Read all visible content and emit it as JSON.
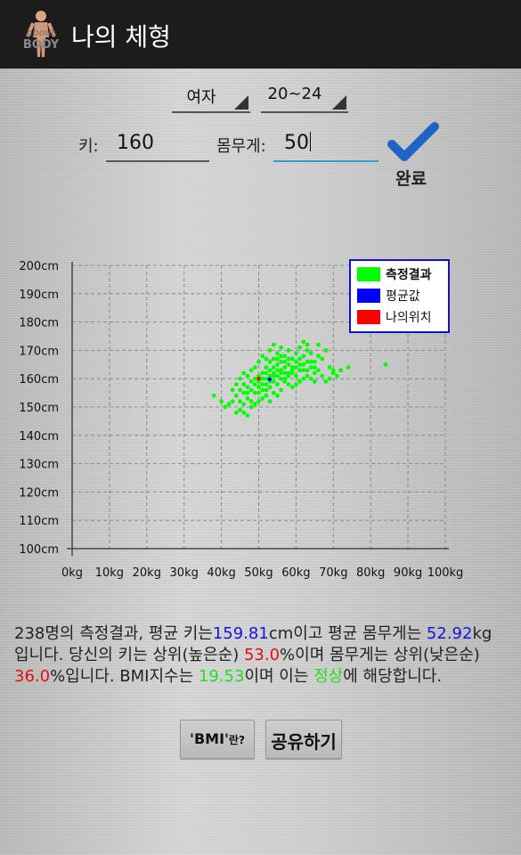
{
  "titlebar": {
    "title": "나의 체형",
    "logo_text_top": "about",
    "logo_text_bottom": "BODY"
  },
  "form": {
    "gender": "여자",
    "age_group": "20~24",
    "height_label": "키:",
    "height_value": "160",
    "weight_label": "몸무게:",
    "weight_value": "50",
    "done_label": "완료"
  },
  "chart_data": {
    "type": "scatter",
    "xlabel": "",
    "ylabel": "",
    "x_ticks": [
      "0kg",
      "10kg",
      "20kg",
      "30kg",
      "40kg",
      "50kg",
      "60kg",
      "70kg",
      "80kg",
      "90kg",
      "100kg"
    ],
    "y_ticks": [
      "100cm",
      "110cm",
      "120cm",
      "130cm",
      "140cm",
      "150cm",
      "160cm",
      "170cm",
      "180cm",
      "190cm",
      "200cm"
    ],
    "xlim": [
      0,
      100
    ],
    "ylim": [
      100,
      200
    ],
    "grid": true,
    "legend_position": "top-right",
    "legend": [
      {
        "label": "측정결과",
        "color": "#00ff00"
      },
      {
        "label": "평균값",
        "color": "#0000ff"
      },
      {
        "label": "나의위치",
        "color": "#ff0000"
      }
    ],
    "series": [
      {
        "name": "측정결과",
        "color": "#00ff00",
        "points": [
          [
            44,
            154
          ],
          [
            45,
            156
          ],
          [
            46,
            158
          ],
          [
            47,
            157
          ],
          [
            48,
            159
          ],
          [
            49,
            160
          ],
          [
            50,
            161
          ],
          [
            51,
            162
          ],
          [
            52,
            160
          ],
          [
            53,
            159
          ],
          [
            54,
            161
          ],
          [
            55,
            163
          ],
          [
            56,
            162
          ],
          [
            57,
            164
          ],
          [
            58,
            165
          ],
          [
            59,
            163
          ],
          [
            60,
            166
          ],
          [
            61,
            167
          ],
          [
            62,
            168
          ],
          [
            63,
            170
          ],
          [
            64,
            169
          ],
          [
            65,
            166
          ],
          [
            66,
            168
          ],
          [
            67,
            167
          ],
          [
            68,
            170
          ],
          [
            69,
            164
          ],
          [
            70,
            163
          ],
          [
            71,
            161
          ],
          [
            72,
            163
          ],
          [
            74,
            164
          ],
          [
            84,
            165
          ],
          [
            38,
            154
          ],
          [
            40,
            152
          ],
          [
            41,
            150
          ],
          [
            42,
            151
          ],
          [
            43,
            152
          ],
          [
            44,
            148
          ],
          [
            45,
            149
          ],
          [
            46,
            151
          ],
          [
            47,
            153
          ],
          [
            48,
            152
          ],
          [
            49,
            155
          ],
          [
            50,
            157
          ],
          [
            51,
            156
          ],
          [
            52,
            158
          ],
          [
            53,
            157
          ],
          [
            54,
            159
          ],
          [
            55,
            158
          ],
          [
            56,
            160
          ],
          [
            57,
            159
          ],
          [
            58,
            161
          ],
          [
            59,
            162
          ],
          [
            60,
            164
          ],
          [
            61,
            163
          ],
          [
            62,
            165
          ],
          [
            63,
            163
          ],
          [
            64,
            166
          ],
          [
            65,
            164
          ],
          [
            43,
            156
          ],
          [
            44,
            158
          ],
          [
            45,
            160
          ],
          [
            46,
            162
          ],
          [
            47,
            161
          ],
          [
            48,
            163
          ],
          [
            49,
            164
          ],
          [
            50,
            166
          ],
          [
            51,
            168
          ],
          [
            52,
            167
          ],
          [
            53,
            170
          ],
          [
            54,
            172
          ],
          [
            55,
            169
          ],
          [
            56,
            171
          ],
          [
            57,
            168
          ],
          [
            58,
            170
          ],
          [
            59,
            167
          ],
          [
            60,
            169
          ],
          [
            61,
            171
          ],
          [
            62,
            173
          ],
          [
            63,
            172
          ],
          [
            66,
            172
          ],
          [
            52,
            162
          ],
          [
            53,
            163
          ],
          [
            54,
            164
          ],
          [
            55,
            165
          ],
          [
            56,
            166
          ],
          [
            57,
            162
          ],
          [
            58,
            158
          ],
          [
            59,
            157
          ],
          [
            60,
            158
          ],
          [
            61,
            159
          ],
          [
            62,
            160
          ],
          [
            63,
            161
          ],
          [
            64,
            160
          ],
          [
            65,
            159
          ],
          [
            67,
            161
          ],
          [
            68,
            159
          ],
          [
            69,
            160
          ],
          [
            70,
            162
          ],
          [
            48,
            150
          ],
          [
            49,
            151
          ],
          [
            50,
            152
          ],
          [
            51,
            153
          ],
          [
            52,
            154
          ],
          [
            53,
            152
          ],
          [
            54,
            155
          ],
          [
            55,
            154
          ],
          [
            56,
            156
          ],
          [
            47,
            147
          ],
          [
            46,
            148
          ],
          [
            45,
            152
          ],
          [
            50,
            155
          ],
          [
            51,
            158
          ],
          [
            52,
            156
          ],
          [
            53,
            161
          ],
          [
            54,
            162
          ],
          [
            55,
            161
          ],
          [
            56,
            163
          ],
          [
            57,
            160
          ],
          [
            58,
            162
          ],
          [
            59,
            164
          ],
          [
            60,
            161
          ],
          [
            49,
            158
          ],
          [
            48,
            156
          ],
          [
            47,
            155
          ],
          [
            46,
            155
          ],
          [
            50,
            159
          ],
          [
            51,
            160
          ],
          [
            52,
            164
          ],
          [
            53,
            166
          ],
          [
            54,
            167
          ],
          [
            55,
            167
          ],
          [
            56,
            168
          ],
          [
            57,
            166
          ],
          [
            58,
            167
          ],
          [
            61,
            165
          ],
          [
            62,
            163
          ],
          [
            63,
            166
          ],
          [
            64,
            164
          ],
          [
            65,
            162
          ],
          [
            66,
            163
          ]
        ]
      },
      {
        "name": "평균값",
        "color": "#0000ff",
        "points": [
          [
            52.92,
            159.81
          ]
        ]
      },
      {
        "name": "나의위치",
        "color": "#ff0000",
        "points": [
          [
            50,
            160
          ]
        ]
      }
    ]
  },
  "result": {
    "count_text": "238명의 측정결과, 평균 키는",
    "avg_height": "159.81",
    "unit_cm_text": "cm이고 평균 몸무게는",
    "avg_weight": "52.92",
    "unit_kg_text": "kg입니다. 당신의 키는 상위(높은순)",
    "height_rank": "53.0",
    "rank_text_mid": "%이며 몸무게는 상위(낮은순)",
    "weight_rank": "36.0",
    "rank_text_end": "%입니다. BMI지수는",
    "bmi": "19.53",
    "bmi_text": "이며 이는",
    "bmi_category": "정상",
    "end_text": "에 해당합니다."
  },
  "buttons": {
    "bmi_quote": "'BMI'",
    "bmi_suffix": "란?",
    "share": "공유하기"
  }
}
